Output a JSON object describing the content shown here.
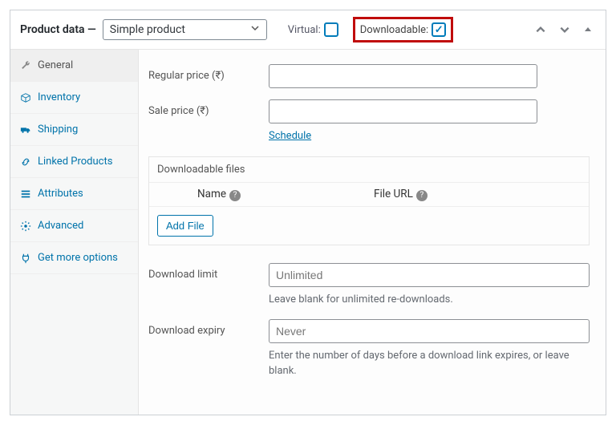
{
  "header": {
    "title": "Product data —",
    "type": "Simple product",
    "virtual_label": "Virtual:",
    "virtual_checked": false,
    "downloadable_label": "Downloadable:",
    "downloadable_checked": true
  },
  "tabs": [
    {
      "icon": "wrench",
      "label": "General",
      "active": true
    },
    {
      "icon": "box",
      "label": "Inventory",
      "active": false
    },
    {
      "icon": "truck",
      "label": "Shipping",
      "active": false
    },
    {
      "icon": "link",
      "label": "Linked Products",
      "active": false
    },
    {
      "icon": "list",
      "label": "Attributes",
      "active": false
    },
    {
      "icon": "gear",
      "label": "Advanced",
      "active": false
    },
    {
      "icon": "plug",
      "label": "Get more options",
      "active": false
    }
  ],
  "fields": {
    "regular_price_label": "Regular price (₹)",
    "sale_price_label": "Sale price (₹)",
    "schedule": "Schedule",
    "dl_files_caption": "Downloadable files",
    "dl_col_name": "Name",
    "dl_col_url": "File URL",
    "add_file": "Add File",
    "download_limit_label": "Download limit",
    "download_limit_placeholder": "Unlimited",
    "download_limit_help": "Leave blank for unlimited re-downloads.",
    "download_expiry_label": "Download expiry",
    "download_expiry_placeholder": "Never",
    "download_expiry_help": "Enter the number of days before a download link expires, or leave blank."
  }
}
